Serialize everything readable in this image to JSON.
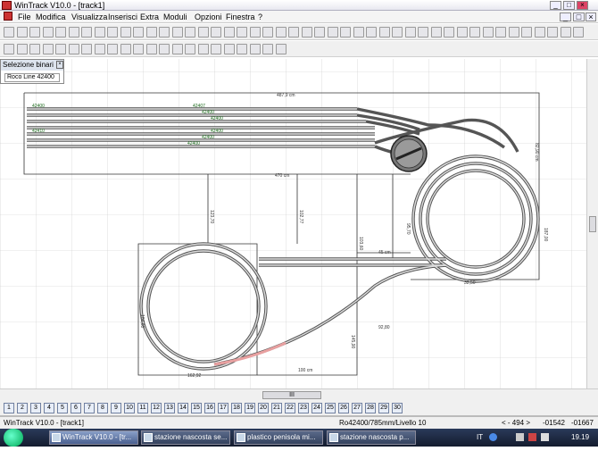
{
  "window": {
    "title": "WinTrack  V10.0 - [track1]"
  },
  "menu": [
    "File",
    "Modifica",
    "Visualizza",
    "Inserisci",
    "Extra",
    "Moduli",
    "Opzioni",
    "Finestra",
    "?"
  ],
  "panel": {
    "title": "Selezione binari",
    "selection": "Roco Line 42400"
  },
  "canvas": {
    "dims": {
      "top": "487,9 cm",
      "top_right": "82,90 cm",
      "main_width": "470 cm",
      "right": "187,00",
      "bottom_left_h": "104,80",
      "bottom_w": "100 cm",
      "mid_w": "45 cm",
      "left_v": "123,70",
      "mid_v": "102,77",
      "center_v": "103,60",
      "v2": "95,70",
      "bottom_center": "145,90",
      "center_bottom": "92,80",
      "right_lower": "32,50",
      "left_lower": "162,92"
    },
    "rail_labels": [
      "42400",
      "42407",
      "42400",
      "42400",
      "42410",
      "42400",
      "42400",
      "42400"
    ],
    "colors": {
      "track": "#555555",
      "ties": "#8a8a8a",
      "label": "#1a6a1a",
      "grid": "#c8c8c8",
      "highlight": "#e8a0a0"
    }
  },
  "scroll": {
    "h_thumb": "III"
  },
  "layers": [
    "1",
    "2",
    "3",
    "4",
    "5",
    "6",
    "7",
    "8",
    "9",
    "10",
    "11",
    "12",
    "13",
    "14",
    "15",
    "16",
    "17",
    "18",
    "19",
    "20",
    "21",
    "22",
    "23",
    "24",
    "25",
    "26",
    "27",
    "28",
    "29",
    "30"
  ],
  "status": {
    "doc": "WinTrack  V10.0 - [track1]",
    "track": "Ro42400/785mm/Livello 10",
    "coord1": "< - 494 >",
    "coord2": "-01542",
    "coord3": "-01667"
  },
  "taskbar": {
    "tasks": [
      "WinTrack  V10.0 - [tr...",
      "stazione nascosta se...",
      "plastico penisola mi...",
      "stazione nascosta p..."
    ],
    "lang": "IT",
    "clock": "19.19"
  }
}
